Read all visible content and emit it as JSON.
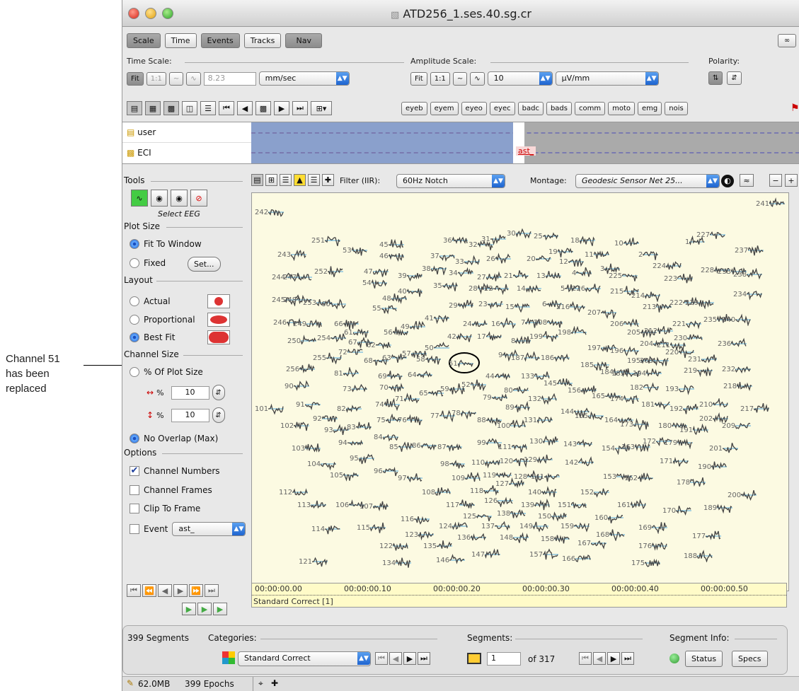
{
  "annotation": {
    "lines": [
      "Channel 51",
      "has been",
      "replaced"
    ]
  },
  "window": {
    "title": "ATD256_1.ses.40.sg.cr"
  },
  "top_tabs": [
    "Scale",
    "Time",
    "Events",
    "Tracks",
    "Nav"
  ],
  "scale_bar": {
    "time_scale_label": "Time Scale:",
    "fit": "Fit",
    "one_to_one": "1:1",
    "time_value": "8.23",
    "time_units": "mm/sec",
    "amp_scale_label": "Amplitude Scale:",
    "amp_fit": "Fit",
    "amp_one_to_one": "1:1",
    "amp_value": "10",
    "amp_units": "µV/mm",
    "polarity_label": "Polarity:"
  },
  "event_codes": [
    "eyeb",
    "eyem",
    "eyeo",
    "eyec",
    "badc",
    "bads",
    "comm",
    "moto",
    "emg",
    "nois"
  ],
  "tracks": [
    {
      "label": "user"
    },
    {
      "label": "ECI",
      "marker": "ast_"
    }
  ],
  "tools": {
    "label": "Tools",
    "select_eeg": "Select EEG",
    "plot_size": "Plot Size",
    "fit_to_window": "Fit To Window",
    "fixed": "Fixed",
    "set": "Set...",
    "layout": "Layout",
    "actual": "Actual",
    "proportional": "Proportional",
    "best_fit": "Best Fit",
    "channel_size": "Channel Size",
    "pct_of_plot": "% Of Plot Size",
    "width_pct": "10",
    "height_pct": "10",
    "pct_sign": "%",
    "no_overlap": "No Overlap (Max)",
    "options": "Options",
    "channel_numbers": "Channel Numbers",
    "channel_frames": "Channel Frames",
    "clip_to_frame": "Clip To Frame",
    "event": "Event",
    "event_value": "ast_"
  },
  "plot_toolbar": {
    "filter_label": "Filter (IIR):",
    "filter_value": "60Hz Notch",
    "montage_label": "Montage:",
    "montage_value": "Geodesic Sensor Net 25..."
  },
  "channels": [
    {
      "n": "242"
    },
    {
      "n": "241"
    },
    {
      "n": "251"
    },
    {
      "n": "53"
    },
    {
      "n": "45"
    },
    {
      "n": "36"
    },
    {
      "n": "31"
    },
    {
      "n": "30"
    },
    {
      "n": "25"
    },
    {
      "n": "18"
    },
    {
      "n": "10"
    },
    {
      "n": "1"
    },
    {
      "n": "227"
    },
    {
      "n": "243"
    },
    {
      "n": "46"
    },
    {
      "n": "37"
    },
    {
      "n": "32"
    },
    {
      "n": "33"
    },
    {
      "n": "26"
    },
    {
      "n": "20"
    },
    {
      "n": "19"
    },
    {
      "n": "12"
    },
    {
      "n": "11"
    },
    {
      "n": "2"
    },
    {
      "n": "237"
    },
    {
      "n": "244"
    },
    {
      "n": "247"
    },
    {
      "n": "252"
    },
    {
      "n": "47"
    },
    {
      "n": "39"
    },
    {
      "n": "38"
    },
    {
      "n": "34"
    },
    {
      "n": "27"
    },
    {
      "n": "21"
    },
    {
      "n": "13"
    },
    {
      "n": "4"
    },
    {
      "n": "3"
    },
    {
      "n": "225"
    },
    {
      "n": "224"
    },
    {
      "n": "223"
    },
    {
      "n": "228"
    },
    {
      "n": "233"
    },
    {
      "n": "238"
    },
    {
      "n": "54"
    },
    {
      "n": "35"
    },
    {
      "n": "28"
    },
    {
      "n": "22"
    },
    {
      "n": "14"
    },
    {
      "n": "5"
    },
    {
      "n": "226"
    },
    {
      "n": "215"
    },
    {
      "n": "214"
    },
    {
      "n": "234"
    },
    {
      "n": "245"
    },
    {
      "n": "248"
    },
    {
      "n": "253"
    },
    {
      "n": "60"
    },
    {
      "n": "48"
    },
    {
      "n": "40"
    },
    {
      "n": "55"
    },
    {
      "n": "29"
    },
    {
      "n": "23"
    },
    {
      "n": "15"
    },
    {
      "n": "6"
    },
    {
      "n": "216"
    },
    {
      "n": "207"
    },
    {
      "n": "213"
    },
    {
      "n": "222"
    },
    {
      "n": "229"
    },
    {
      "n": "246"
    },
    {
      "n": "249"
    },
    {
      "n": "66"
    },
    {
      "n": "61"
    },
    {
      "n": "56"
    },
    {
      "n": "49"
    },
    {
      "n": "41"
    },
    {
      "n": "24"
    },
    {
      "n": "16"
    },
    {
      "n": "7"
    },
    {
      "n": "208"
    },
    {
      "n": "198"
    },
    {
      "n": "206"
    },
    {
      "n": "205"
    },
    {
      "n": "212"
    },
    {
      "n": "221"
    },
    {
      "n": "235"
    },
    {
      "n": "240"
    },
    {
      "n": "250"
    },
    {
      "n": "254"
    },
    {
      "n": "67"
    },
    {
      "n": "62"
    },
    {
      "n": "57"
    },
    {
      "n": "50"
    },
    {
      "n": "42"
    },
    {
      "n": "17"
    },
    {
      "n": "8"
    },
    {
      "n": "199"
    },
    {
      "n": "197"
    },
    {
      "n": "196"
    },
    {
      "n": "204"
    },
    {
      "n": "211"
    },
    {
      "n": "230"
    },
    {
      "n": "236"
    },
    {
      "n": "255"
    },
    {
      "n": "72"
    },
    {
      "n": "68"
    },
    {
      "n": "63"
    },
    {
      "n": "58"
    },
    {
      "n": "51"
    },
    {
      "n": "9"
    },
    {
      "n": "187"
    },
    {
      "n": "186"
    },
    {
      "n": "185"
    },
    {
      "n": "195"
    },
    {
      "n": "203"
    },
    {
      "n": "220"
    },
    {
      "n": "231"
    },
    {
      "n": "256"
    },
    {
      "n": "81"
    },
    {
      "n": "69"
    },
    {
      "n": "64"
    },
    {
      "n": "52"
    },
    {
      "n": "44"
    },
    {
      "n": "133"
    },
    {
      "n": "145"
    },
    {
      "n": "184"
    },
    {
      "n": "183"
    },
    {
      "n": "194"
    },
    {
      "n": "219"
    },
    {
      "n": "232"
    },
    {
      "n": "90"
    },
    {
      "n": "73"
    },
    {
      "n": "70"
    },
    {
      "n": "71"
    },
    {
      "n": "65"
    },
    {
      "n": "59"
    },
    {
      "n": "80"
    },
    {
      "n": "156"
    },
    {
      "n": "182"
    },
    {
      "n": "193"
    },
    {
      "n": "218"
    },
    {
      "n": "91"
    },
    {
      "n": "74"
    },
    {
      "n": "79"
    },
    {
      "n": "132"
    },
    {
      "n": "165"
    },
    {
      "n": "174"
    },
    {
      "n": "101"
    },
    {
      "n": "82"
    },
    {
      "n": "77"
    },
    {
      "n": "78"
    },
    {
      "n": "89"
    },
    {
      "n": "131"
    },
    {
      "n": "144"
    },
    {
      "n": "155"
    },
    {
      "n": "164"
    },
    {
      "n": "173"
    },
    {
      "n": "181"
    },
    {
      "n": "192"
    },
    {
      "n": "210"
    },
    {
      "n": "217"
    },
    {
      "n": "92"
    },
    {
      "n": "75"
    },
    {
      "n": "76"
    },
    {
      "n": "88"
    },
    {
      "n": "100"
    },
    {
      "n": "180"
    },
    {
      "n": "191"
    },
    {
      "n": "202"
    },
    {
      "n": "209"
    },
    {
      "n": "102"
    },
    {
      "n": "93"
    },
    {
      "n": "83"
    },
    {
      "n": "84"
    },
    {
      "n": "85"
    },
    {
      "n": "86"
    },
    {
      "n": "87"
    },
    {
      "n": "99"
    },
    {
      "n": "111"
    },
    {
      "n": "130"
    },
    {
      "n": "143"
    },
    {
      "n": "154"
    },
    {
      "n": "163"
    },
    {
      "n": "172"
    },
    {
      "n": "179"
    },
    {
      "n": "201"
    },
    {
      "n": "103"
    },
    {
      "n": "94"
    },
    {
      "n": "95"
    },
    {
      "n": "98"
    },
    {
      "n": "110"
    },
    {
      "n": "120"
    },
    {
      "n": "129"
    },
    {
      "n": "142"
    },
    {
      "n": "171"
    },
    {
      "n": "190"
    },
    {
      "n": "104"
    },
    {
      "n": "105"
    },
    {
      "n": "96"
    },
    {
      "n": "97"
    },
    {
      "n": "109"
    },
    {
      "n": "119"
    },
    {
      "n": "127"
    },
    {
      "n": "128"
    },
    {
      "n": "141"
    },
    {
      "n": "153"
    },
    {
      "n": "162"
    },
    {
      "n": "178"
    },
    {
      "n": "112"
    },
    {
      "n": "108"
    },
    {
      "n": "118"
    },
    {
      "n": "126"
    },
    {
      "n": "140"
    },
    {
      "n": "152"
    },
    {
      "n": "200"
    },
    {
      "n": "113"
    },
    {
      "n": "106"
    },
    {
      "n": "107"
    },
    {
      "n": "117"
    },
    {
      "n": "125"
    },
    {
      "n": "138"
    },
    {
      "n": "139"
    },
    {
      "n": "151"
    },
    {
      "n": "150"
    },
    {
      "n": "161"
    },
    {
      "n": "170"
    },
    {
      "n": "189"
    },
    {
      "n": "114"
    },
    {
      "n": "115"
    },
    {
      "n": "116"
    },
    {
      "n": "124"
    },
    {
      "n": "137"
    },
    {
      "n": "149"
    },
    {
      "n": "159"
    },
    {
      "n": "160"
    },
    {
      "n": "169"
    },
    {
      "n": "123"
    },
    {
      "n": "136"
    },
    {
      "n": "148"
    },
    {
      "n": "158"
    },
    {
      "n": "167"
    },
    {
      "n": "168"
    },
    {
      "n": "177"
    },
    {
      "n": "122"
    },
    {
      "n": "135"
    },
    {
      "n": "176"
    },
    {
      "n": "121"
    },
    {
      "n": "134"
    },
    {
      "n": "146"
    },
    {
      "n": "147"
    },
    {
      "n": "157"
    },
    {
      "n": "166"
    },
    {
      "n": "175"
    },
    {
      "n": "188"
    }
  ],
  "timeline": {
    "ticks": [
      "00:00:00.00",
      "00:00:00.10",
      "00:00:00.20",
      "00:00:00.30",
      "00:00:00.40",
      "00:00:00.50"
    ],
    "label": "Standard Correct [1]"
  },
  "bottom": {
    "segments_count": "399 Segments",
    "categories_label": "Categories:",
    "category_value": "Standard Correct",
    "segments_label": "Segments:",
    "segment_index": "1",
    "segment_of": "of 317",
    "segment_info_label": "Segment Info:",
    "status": "Status",
    "specs": "Specs"
  },
  "status_bar": {
    "memory": "62.0MB",
    "epochs": "399 Epochs"
  }
}
